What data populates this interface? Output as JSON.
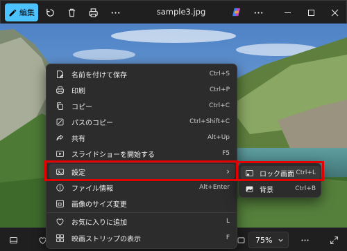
{
  "titlebar": {
    "edit_label": "編集",
    "title": "sample3.jpg",
    "icons": [
      "edit-icon",
      "rotate-icon",
      "delete-icon",
      "print-icon",
      "more-icon",
      "copilot-icon",
      "minimize-icon",
      "maximize-icon",
      "close-icon"
    ]
  },
  "menu": {
    "items": [
      {
        "icon": "save-as-icon",
        "label": "名前を付けて保存",
        "shortcut": "Ctrl+S"
      },
      {
        "icon": "print-icon",
        "label": "印刷",
        "shortcut": "Ctrl+P"
      },
      {
        "icon": "copy-icon",
        "label": "コピー",
        "shortcut": "Ctrl+C"
      },
      {
        "icon": "copy-path-icon",
        "label": "パスのコピー",
        "shortcut": "Ctrl+Shift+C"
      },
      {
        "icon": "share-icon",
        "label": "共有",
        "shortcut": "Alt+Up"
      },
      {
        "icon": "slideshow-icon",
        "label": "スライドショーを開始する",
        "shortcut": "F5"
      },
      {
        "icon": "set-as-icon",
        "label": "設定",
        "shortcut": "›"
      },
      {
        "icon": "info-icon",
        "label": "ファイル情報",
        "shortcut": "Alt+Enter"
      },
      {
        "icon": "resize-icon",
        "label": "画像のサイズ変更",
        "shortcut": ""
      },
      {
        "icon": "heart-icon",
        "label": "お気に入りに追加",
        "shortcut": "L"
      },
      {
        "icon": "filmstrip-icon",
        "label": "映画ストリップの表示",
        "shortcut": "F"
      }
    ]
  },
  "submenu": {
    "items": [
      {
        "icon": "lock-screen-icon",
        "label": "ロック画面",
        "shortcut": "Ctrl+L"
      },
      {
        "icon": "background-icon",
        "label": "背景",
        "shortcut": "Ctrl+B"
      }
    ]
  },
  "bottombar": {
    "zoom": "75%",
    "icons": [
      "filmstrip-toggle-icon",
      "favorite-icon",
      "fit-icon",
      "more-icon",
      "fullscreen-icon"
    ]
  },
  "colors": {
    "accent": "#4cc2ff",
    "highlight_box": "#e30000",
    "menu_bg": "#2c2c2c"
  }
}
